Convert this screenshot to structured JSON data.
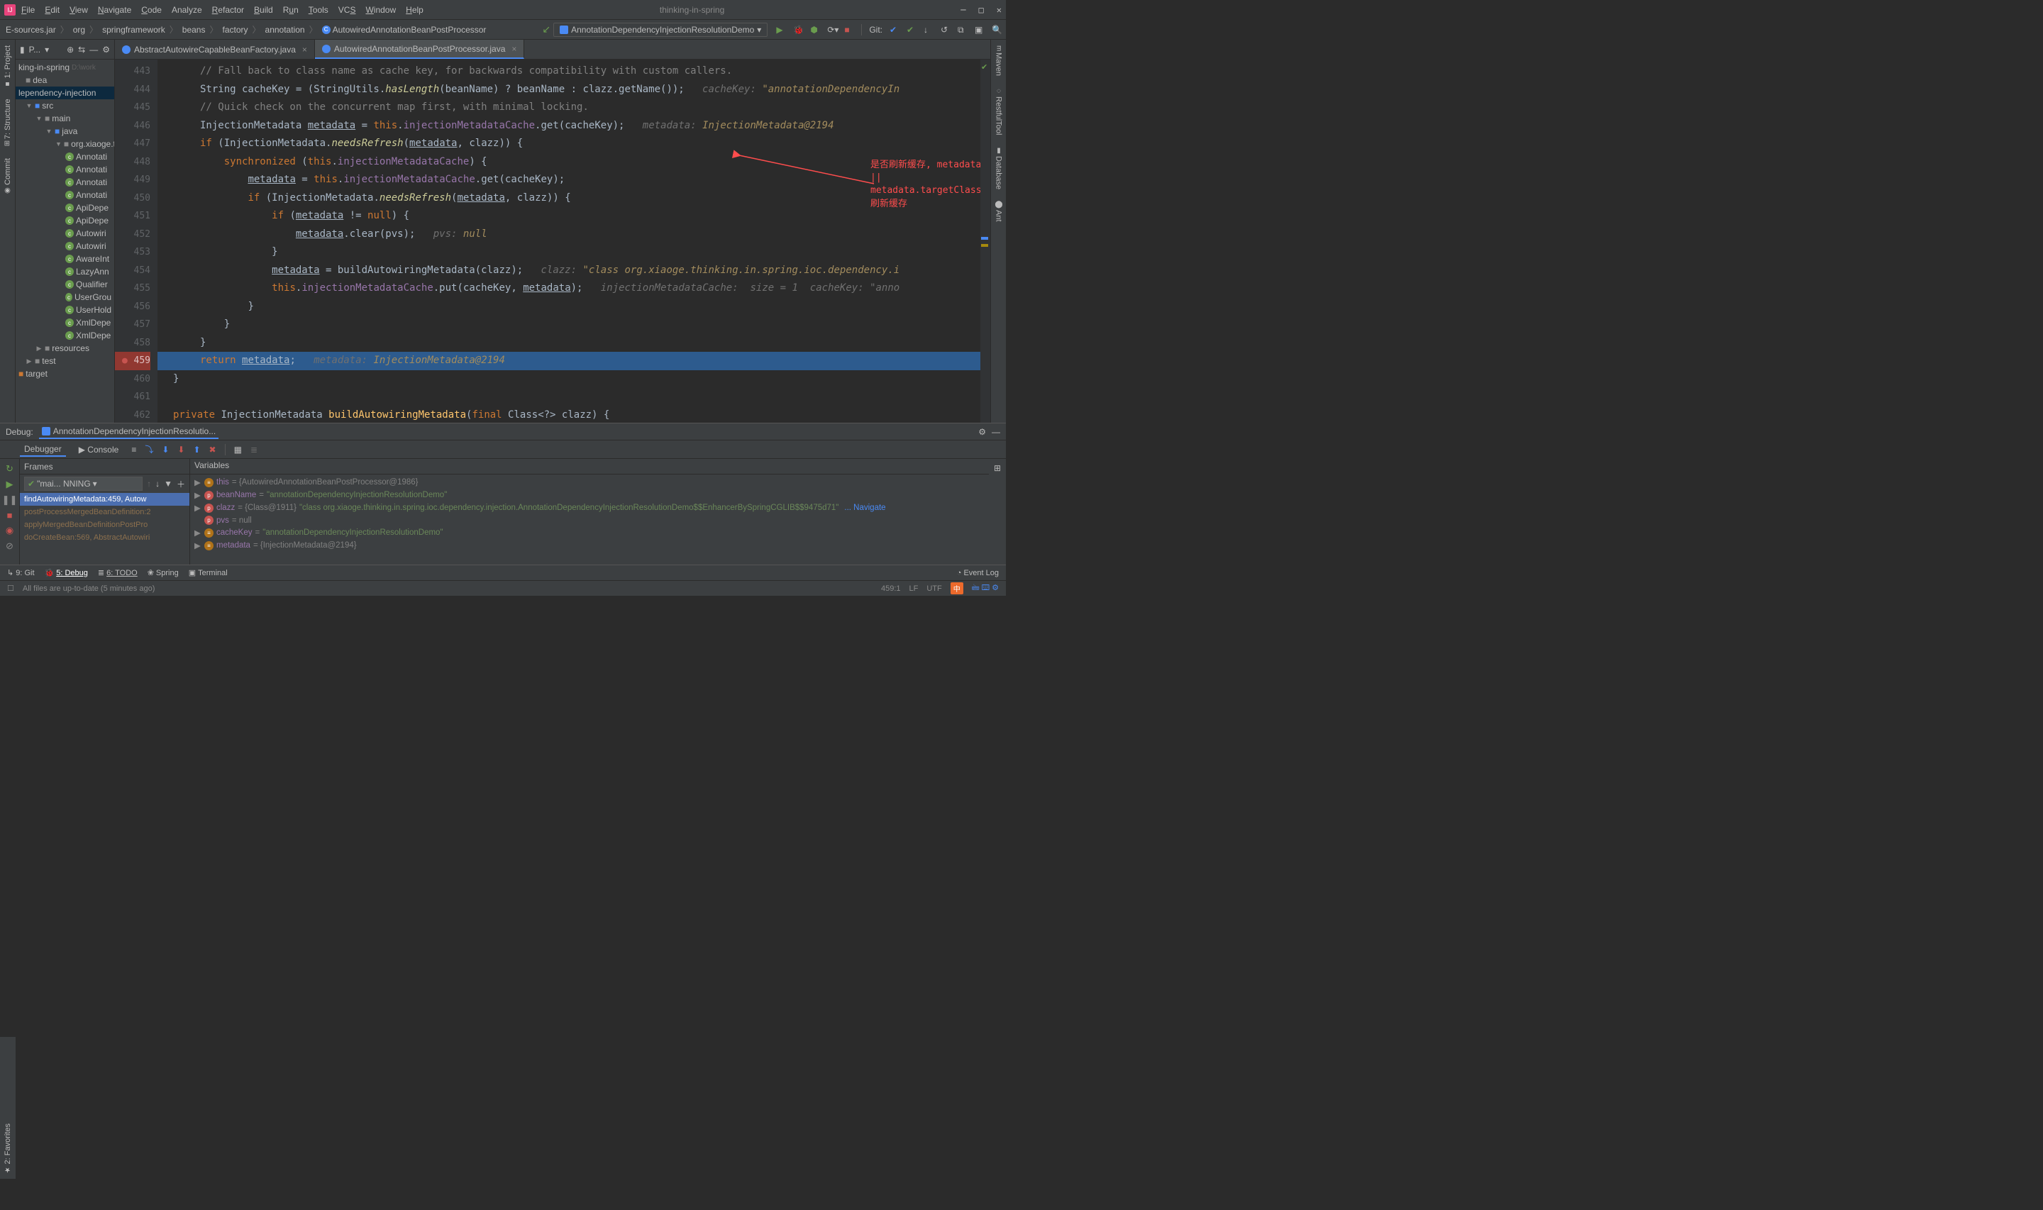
{
  "window": {
    "title": "thinking-in-spring"
  },
  "menu": {
    "file": "File",
    "edit": "Edit",
    "view": "View",
    "navigate": "Navigate",
    "code": "Code",
    "analyze": "Analyze",
    "refactor": "Refactor",
    "build": "Build",
    "run": "Run",
    "tools": "Tools",
    "vcs": "VCS",
    "window": "Window",
    "help": "Help"
  },
  "breadcrumb": {
    "root": "E-sources.jar",
    "p1": "org",
    "p2": "springframework",
    "p3": "beans",
    "p4": "factory",
    "p5": "annotation",
    "file": "AutowiredAnnotationBeanPostProcessor"
  },
  "run_config": {
    "name": "AnnotationDependencyInjectionResolutionDemo"
  },
  "git": {
    "label": "Git:"
  },
  "left_tabs": {
    "project": "1: Project",
    "structure": "7: Structure",
    "commit": "Commit",
    "favorites": "2: Favorites"
  },
  "right_tabs": {
    "maven": "Maven",
    "restful": "RestfulTool",
    "database": "Database",
    "ant": "Ant"
  },
  "project_panel": {
    "label": "P...",
    "root": "king-in-spring",
    "root_path": "D:\\work",
    "idea": "dea",
    "module": "lependency-injection",
    "src": "src",
    "main": "main",
    "java": "java",
    "pkg": "org.xiaoge.t",
    "items": [
      "Annotati",
      "Annotati",
      "Annotati",
      "Annotati",
      "ApiDepe",
      "ApiDepe",
      "Autowiri",
      "Autowiri",
      "AwareInt",
      "LazyAnn",
      "Qualifier",
      "UserGrou",
      "UserHold",
      "XmlDepe",
      "XmlDepe"
    ],
    "resources": "resources",
    "test": "test",
    "target": "target"
  },
  "editor": {
    "tabs": {
      "t0": "AbstractAutowireCapableBeanFactory.java",
      "t1": "AutowiredAnnotationBeanPostProcessor.java"
    }
  },
  "lines": {
    "n443": "443",
    "n444": "444",
    "n445": "445",
    "n446": "446",
    "n447": "447",
    "n448": "448",
    "n449": "449",
    "n450": "450",
    "n451": "451",
    "n452": "452",
    "n453": "453",
    "n454": "454",
    "n455": "455",
    "n456": "456",
    "n457": "457",
    "n458": "458",
    "n459": "459",
    "n460": "460",
    "n461": "461",
    "n462": "462"
  },
  "code": {
    "l443": "// Fall back to class name as cache key, for backwards compatibility with custom callers.",
    "l444_a": "String cacheKey = (StringUtils.",
    "l444_b": "hasLength",
    "l444_c": "(beanName) ? beanName : clazz.getName());",
    "l444_hint_l": "cacheKey: ",
    "l444_hint_v": "\"annotationDependencyIn",
    "l445": "// Quick check on the concurrent map first, with minimal locking.",
    "l446_a": "InjectionMetadata ",
    "l446_b": "metadata",
    "l446_c": " = ",
    "l446_d": "this",
    "l446_e": ".",
    "l446_f": "injectionMetadataCache",
    "l446_g": ".get(cacheKey);",
    "l446_hint_l": "metadata: ",
    "l446_hint_v": "InjectionMetadata@2194",
    "l447_a": "if ",
    "l447_b": "(InjectionMetadata.",
    "l447_c": "needsRefresh",
    "l447_d": "(",
    "l447_e": "metadata",
    "l447_f": ", clazz)) {",
    "l448_a": "synchronized ",
    "l448_b": "(",
    "l448_c": "this",
    "l448_d": ".",
    "l448_e": "injectionMetadataCache",
    "l448_f": ") {",
    "l449_a": "metadata",
    "l449_b": " = ",
    "l449_c": "this",
    "l449_d": ".",
    "l449_e": "injectionMetadataCache",
    "l449_f": ".get(cacheKey);",
    "l450_a": "if ",
    "l450_b": "(InjectionMetadata.",
    "l450_c": "needsRefresh",
    "l450_d": "(",
    "l450_e": "metadata",
    "l450_f": ", clazz)) {",
    "l451_a": "if ",
    "l451_b": "(",
    "l451_c": "metadata",
    "l451_d": " != ",
    "l451_e": "null",
    "l451_f": ") {",
    "l452_a": "metadata",
    "l452_b": ".clear(pvs);",
    "l452_hint_l": "pvs: ",
    "l452_hint_v": "null",
    "l453": "}",
    "l454_a": "metadata",
    "l454_b": " = buildAutowiringMetadata(clazz);",
    "l454_hint_l": "clazz: ",
    "l454_hint_v": "\"class org.xiaoge.thinking.in.spring.ioc.dependency.i",
    "l455_a": "this",
    "l455_b": ".",
    "l455_c": "injectionMetadataCache",
    "l455_d": ".put(cacheKey, ",
    "l455_e": "metadata",
    "l455_f": ");",
    "l455_hint_l": "injectionMetadataCache:  size = 1  cacheKey: \"anno",
    "l456": "}",
    "l457": "}",
    "l458": "}",
    "l459_a": "return ",
    "l459_b": "metadata",
    "l459_c": ";",
    "l459_hint_l": "metadata: ",
    "l459_hint_v": "InjectionMetadata@2194",
    "l460": "}",
    "l462_a": "private ",
    "l462_b": "InjectionMetadata ",
    "l462_c": "buildAutowiringMetadata",
    "l462_d": "(",
    "l462_e": "final ",
    "l462_f": "Class<?> clazz) {"
  },
  "annotation": "是否刷新缓存, metadata==null ||\nmetadata.targetClass!=clazz刷新缓存",
  "debug": {
    "label": "Debug:",
    "run_tab": "AnnotationDependencyInjectionResolutio...",
    "tabs": {
      "debugger": "Debugger",
      "console": "Console"
    },
    "frames_label": "Frames",
    "thread": "\"mai... NNING",
    "frames": {
      "f0": "findAutowiringMetadata:459, Autow",
      "f1": "postProcessMergedBeanDefinition:2",
      "f2": "applyMergedBeanDefinitionPostPro",
      "f3": "doCreateBean:569, AbstractAutowiri"
    },
    "vars_label": "Variables",
    "vars": {
      "this_n": "this",
      "this_v": " = {AutowiredAnnotationBeanPostProcessor@1986}",
      "bn_n": "beanName",
      "bn_eq": " = ",
      "bn_v": "\"annotationDependencyInjectionResolutionDemo\"",
      "cl_n": "clazz",
      "cl_eq": " = {Class@1911} ",
      "cl_v": "\"class org.xiaoge.thinking.in.spring.ioc.dependency.injection.AnnotationDependencyInjectionResolutionDemo$$EnhancerBySpringCGLIB$$9475d71\"",
      "cl_nav": "... Navigate",
      "pv_n": "pvs",
      "pv_v": " = null",
      "ck_n": "cacheKey",
      "ck_eq": " = ",
      "ck_v": "\"annotationDependencyInjectionResolutionDemo\"",
      "md_n": "metadata",
      "md_v": " = {InjectionMetadata@2194}"
    }
  },
  "bottom": {
    "git": "9: Git",
    "debug": "5: Debug",
    "todo": "6: TODO",
    "spring": "Spring",
    "terminal": "Terminal",
    "eventlog": "Event Log"
  },
  "status": {
    "msg": "All files are up-to-date (5 minutes ago)",
    "pos": "459:1",
    "le": "LF",
    "enc": "UTF",
    "ime": "中"
  }
}
